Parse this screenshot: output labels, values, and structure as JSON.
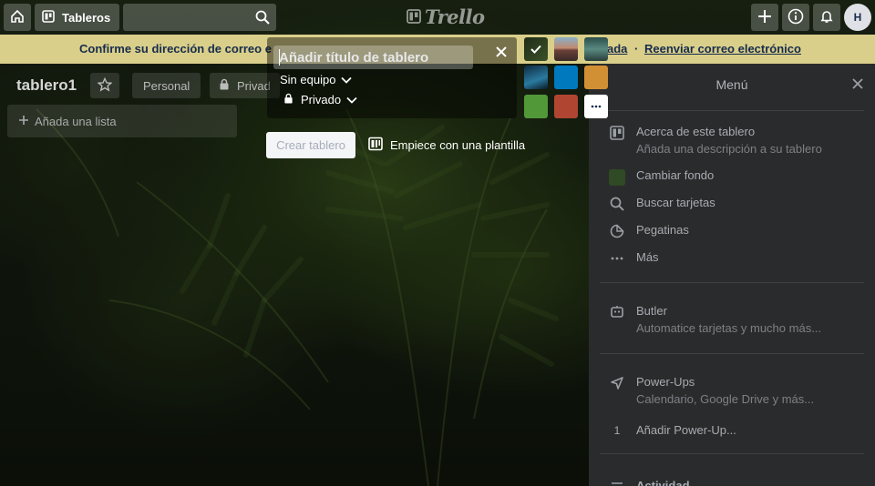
{
  "header": {
    "home_icon": "home-icon",
    "boards_label": "Tableros",
    "search_placeholder": "",
    "logo_text": "Trello",
    "avatar_initial": "H"
  },
  "banner": {
    "text": "Confirme su dirección de correo e",
    "link1": "ada",
    "separator": "·",
    "link2": "Reenviar correo electrónico"
  },
  "board": {
    "title": "tablero1",
    "team_label": "Personal",
    "visibility_label": "Privad",
    "add_list_label": "Añada una lista"
  },
  "create_board": {
    "title_placeholder": "Añadir título de tablero",
    "team_label": "Sin equipo",
    "visibility_label": "Privado",
    "create_button": "Crear tablero",
    "template_link": "Empiece con una plantilla",
    "swatches": [
      {
        "name": "swatch-photo-dark-green",
        "color": "#2d3d22",
        "selected": true
      },
      {
        "name": "swatch-photo-road",
        "color": "#9a6a5a",
        "selected": false
      },
      {
        "name": "swatch-photo-mountain",
        "color": "#3d6a6a",
        "selected": false
      },
      {
        "name": "swatch-photo-wave",
        "color": "#1a5a7a",
        "selected": false
      },
      {
        "name": "swatch-blue",
        "color": "#0079bf",
        "selected": false
      },
      {
        "name": "swatch-orange",
        "color": "#d29034",
        "selected": false
      },
      {
        "name": "swatch-green",
        "color": "#519839",
        "selected": false
      },
      {
        "name": "swatch-red",
        "color": "#b04632",
        "selected": false
      },
      {
        "name": "swatch-more",
        "color": "#ffffff",
        "selected": false
      }
    ]
  },
  "menu": {
    "title": "Menú",
    "items": [
      {
        "label": "Acerca de este tablero",
        "sub": "Añada una descripción a su tablero"
      },
      {
        "label": "Cambiar fondo"
      },
      {
        "label": "Buscar tarjetas"
      },
      {
        "label": "Pegatinas"
      },
      {
        "label": "Más"
      }
    ],
    "butler": {
      "label": "Butler",
      "sub": "Automatice tarjetas y mucho más..."
    },
    "powerups": {
      "label": "Power-Ups",
      "sub": "Calendario, Google Drive y más..."
    },
    "add_powerup": {
      "count": "1",
      "label": "Añadir Power-Up..."
    },
    "activity_label": "Actividad"
  }
}
